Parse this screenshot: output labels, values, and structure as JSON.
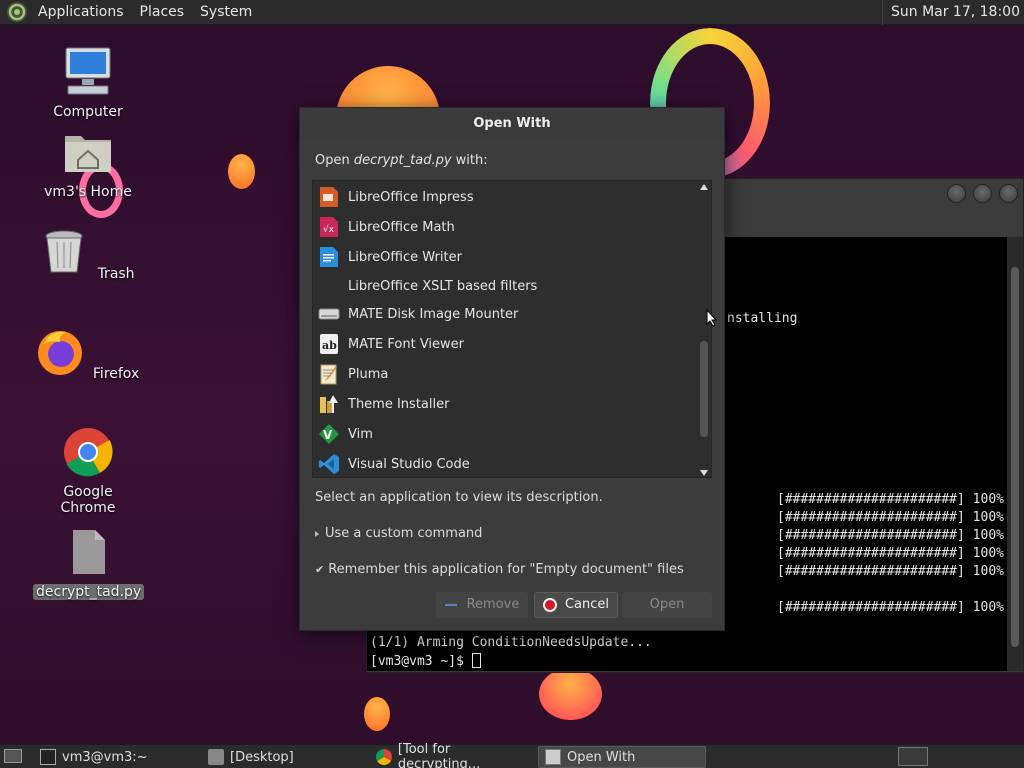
{
  "top_panel": {
    "menus": [
      "Applications",
      "Places",
      "System"
    ],
    "clock": "Sun Mar 17, 18:00"
  },
  "desktop_icons": [
    {
      "label": "Computer",
      "icon": "computer-icon"
    },
    {
      "label": "vm3's Home",
      "icon": "home-folder-icon"
    },
    {
      "label": "Trash",
      "icon": "trash-icon"
    },
    {
      "label": "Firefox",
      "icon": "firefox-icon"
    },
    {
      "label": "Google Chrome",
      "icon": "chrome-icon"
    },
    {
      "label": "decrypt_tad.py",
      "icon": "file-icon",
      "selected": true
    }
  ],
  "terminal": {
    "visible_fragment": "nstalling",
    "progress_lines": [
      "[######################] 100%",
      "[######################] 100%",
      "[######################] 100%",
      "[######################] 100%",
      "[######################] 100%",
      "[######################] 100%"
    ],
    "arming_line": "(1/1) Arming ConditionNeedsUpdate...",
    "prompt": "[vm3@vm3 ~]$ "
  },
  "dialog": {
    "title": "Open With",
    "prompt_prefix": "Open ",
    "prompt_file": "decrypt_tad.py",
    "prompt_suffix": " with:",
    "apps": [
      {
        "name": "LibreOffice Impress",
        "icon": "libreoffice-impress-icon",
        "color": "#d35c24"
      },
      {
        "name": "LibreOffice Math",
        "icon": "libreoffice-math-icon",
        "color": "#c8285a"
      },
      {
        "name": "LibreOffice Writer",
        "icon": "libreoffice-writer-icon",
        "color": "#2a8fd8"
      },
      {
        "name": "LibreOffice XSLT based filters",
        "icon": "none",
        "color": ""
      },
      {
        "name": "MATE Disk Image Mounter",
        "icon": "disk-image-icon",
        "color": "#d8d8d8"
      },
      {
        "name": "MATE Font Viewer",
        "icon": "font-viewer-icon",
        "color": "#f0f0f0"
      },
      {
        "name": "Pluma",
        "icon": "pluma-icon",
        "color": "#e8d9a0"
      },
      {
        "name": "Theme Installer",
        "icon": "theme-installer-icon",
        "color": "#e0a040"
      },
      {
        "name": "Vim",
        "icon": "vim-icon",
        "color": "#1f9a3c"
      },
      {
        "name": "Visual Studio Code",
        "icon": "vscode-icon",
        "color": "#2a8fd8"
      }
    ],
    "description": "Select an application to view its description.",
    "custom_command": "Use a custom command",
    "remember": "Remember this application for \"Empty document\" files",
    "buttons": {
      "remove": "Remove",
      "cancel": "Cancel",
      "open": "Open"
    }
  },
  "taskbar": [
    {
      "label": "vm3@vm3:~",
      "icon": "terminal-icon"
    },
    {
      "label": "[Desktop]",
      "icon": "folder-icon"
    },
    {
      "label": "[Tool for decrypting...",
      "icon": "chrome-icon"
    },
    {
      "label": "Open With",
      "icon": "dialog-icon",
      "active": true
    }
  ]
}
